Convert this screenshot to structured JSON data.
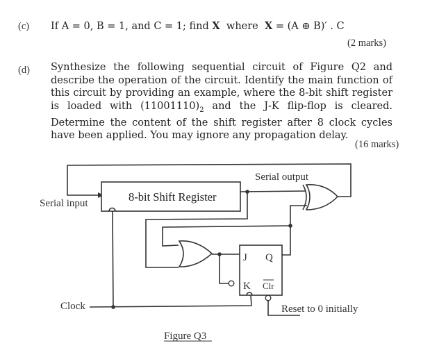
{
  "part_c": {
    "label": "(c)",
    "text_prefix": "If A = 0, B = 1, and C = 1; find ",
    "bold_var": "X",
    "text_mid": "  where  ",
    "bold_var2": "X",
    "expression": " = (A ⊕ B)′ . C",
    "marks": "(2 marks)"
  },
  "part_d": {
    "label": "(d)",
    "paragraph_before_sub": "Synthesize the following sequential circuit of Figure Q2 and describe the operation of the circuit. Identify the main function of this circuit by providing an example, where the 8-bit shift register is loaded with (11001110)",
    "subscript": "2",
    "paragraph_after_sub": " and the J-K flip-flop is cleared. Determine the content of the shift register after 8 clock cycles have been applied. You may ignore any propagation delay.",
    "marks": "(16 marks)"
  },
  "figure": {
    "shift_register_label": "8-bit Shift Register",
    "serial_input_label": "Serial input",
    "serial_output_label": "Serial output",
    "clock_label": "Clock",
    "ff_j": "J",
    "ff_q": "Q",
    "ff_k": "K",
    "ff_clr": "Clr",
    "reset_label": "Reset to 0 initially",
    "caption": "Figure Q3"
  }
}
